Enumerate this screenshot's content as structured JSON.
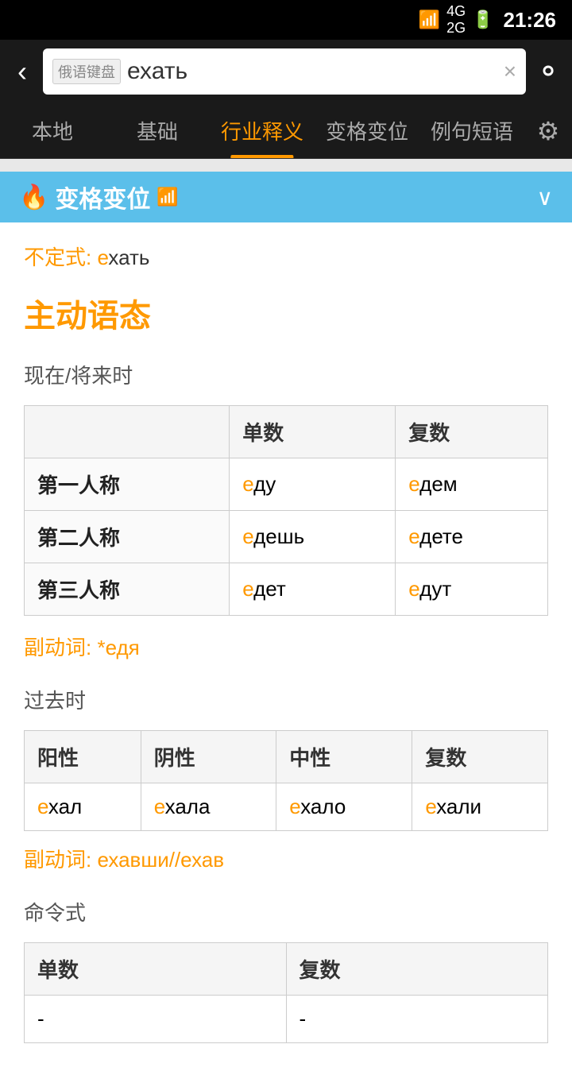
{
  "statusBar": {
    "time": "21:26",
    "wifi": "WiFi",
    "signal": "4G/2G",
    "battery": "🔋"
  },
  "searchBar": {
    "backLabel": "‹",
    "keyboardLabel": "俄语键盘",
    "searchValue": "ехать",
    "clearLabel": "×",
    "searchIconLabel": "🔍"
  },
  "tabs": [
    {
      "id": "local",
      "label": "本地",
      "active": false
    },
    {
      "id": "basic",
      "label": "基础",
      "active": false
    },
    {
      "id": "industry",
      "label": "行业释义",
      "active": true
    },
    {
      "id": "conjugation",
      "label": "变格变位",
      "active": false
    },
    {
      "id": "examples",
      "label": "例句短语",
      "active": false
    }
  ],
  "settingsIcon": "⚙",
  "sectionHeader": {
    "title": "变格变位",
    "icon": "🔥",
    "wifiIcon": "📶",
    "chevron": "⌄"
  },
  "infinitive": {
    "label": "不定式:",
    "accent": "е",
    "rest": "хать"
  },
  "voiceTitle": "主动语态",
  "presentTense": {
    "label": "现在/将来时",
    "headers": [
      "",
      "单数",
      "复数"
    ],
    "rows": [
      {
        "person": "第一人称",
        "singular_accent": "е",
        "singular_rest": "ду",
        "plural_accent": "е",
        "plural_rest": "дем"
      },
      {
        "person": "第二人称",
        "singular_accent": "е",
        "singular_rest": "дешь",
        "plural_accent": "е",
        "plural_rest": "дете"
      },
      {
        "person": "第三人称",
        "singular_accent": "е",
        "singular_rest": "дет",
        "plural_accent": "е",
        "plural_rest": "дут"
      }
    ],
    "gerund": {
      "label": "副动词:",
      "prefix": "*",
      "accent": "е",
      "rest": "дя"
    }
  },
  "pastTense": {
    "label": "过去时",
    "headers": [
      "阳性",
      "阴性",
      "中性",
      "复数"
    ],
    "rows": [
      {
        "masc_accent": "е",
        "masc_rest": "хал",
        "fem_accent": "е",
        "fem_rest": "хала",
        "neut_accent": "е",
        "neut_rest": "хало",
        "plur_accent": "е",
        "plur_rest": "хали"
      }
    ],
    "gerund": {
      "label": "副动词:",
      "accent1": "е",
      "rest1": "хавши//",
      "accent2": "е",
      "rest2": "хав"
    }
  },
  "imperativeTense": {
    "label": "命令式",
    "headers": [
      "单数",
      "复数"
    ],
    "rows": [
      {
        "singular": "-",
        "plural": "-"
      }
    ]
  }
}
